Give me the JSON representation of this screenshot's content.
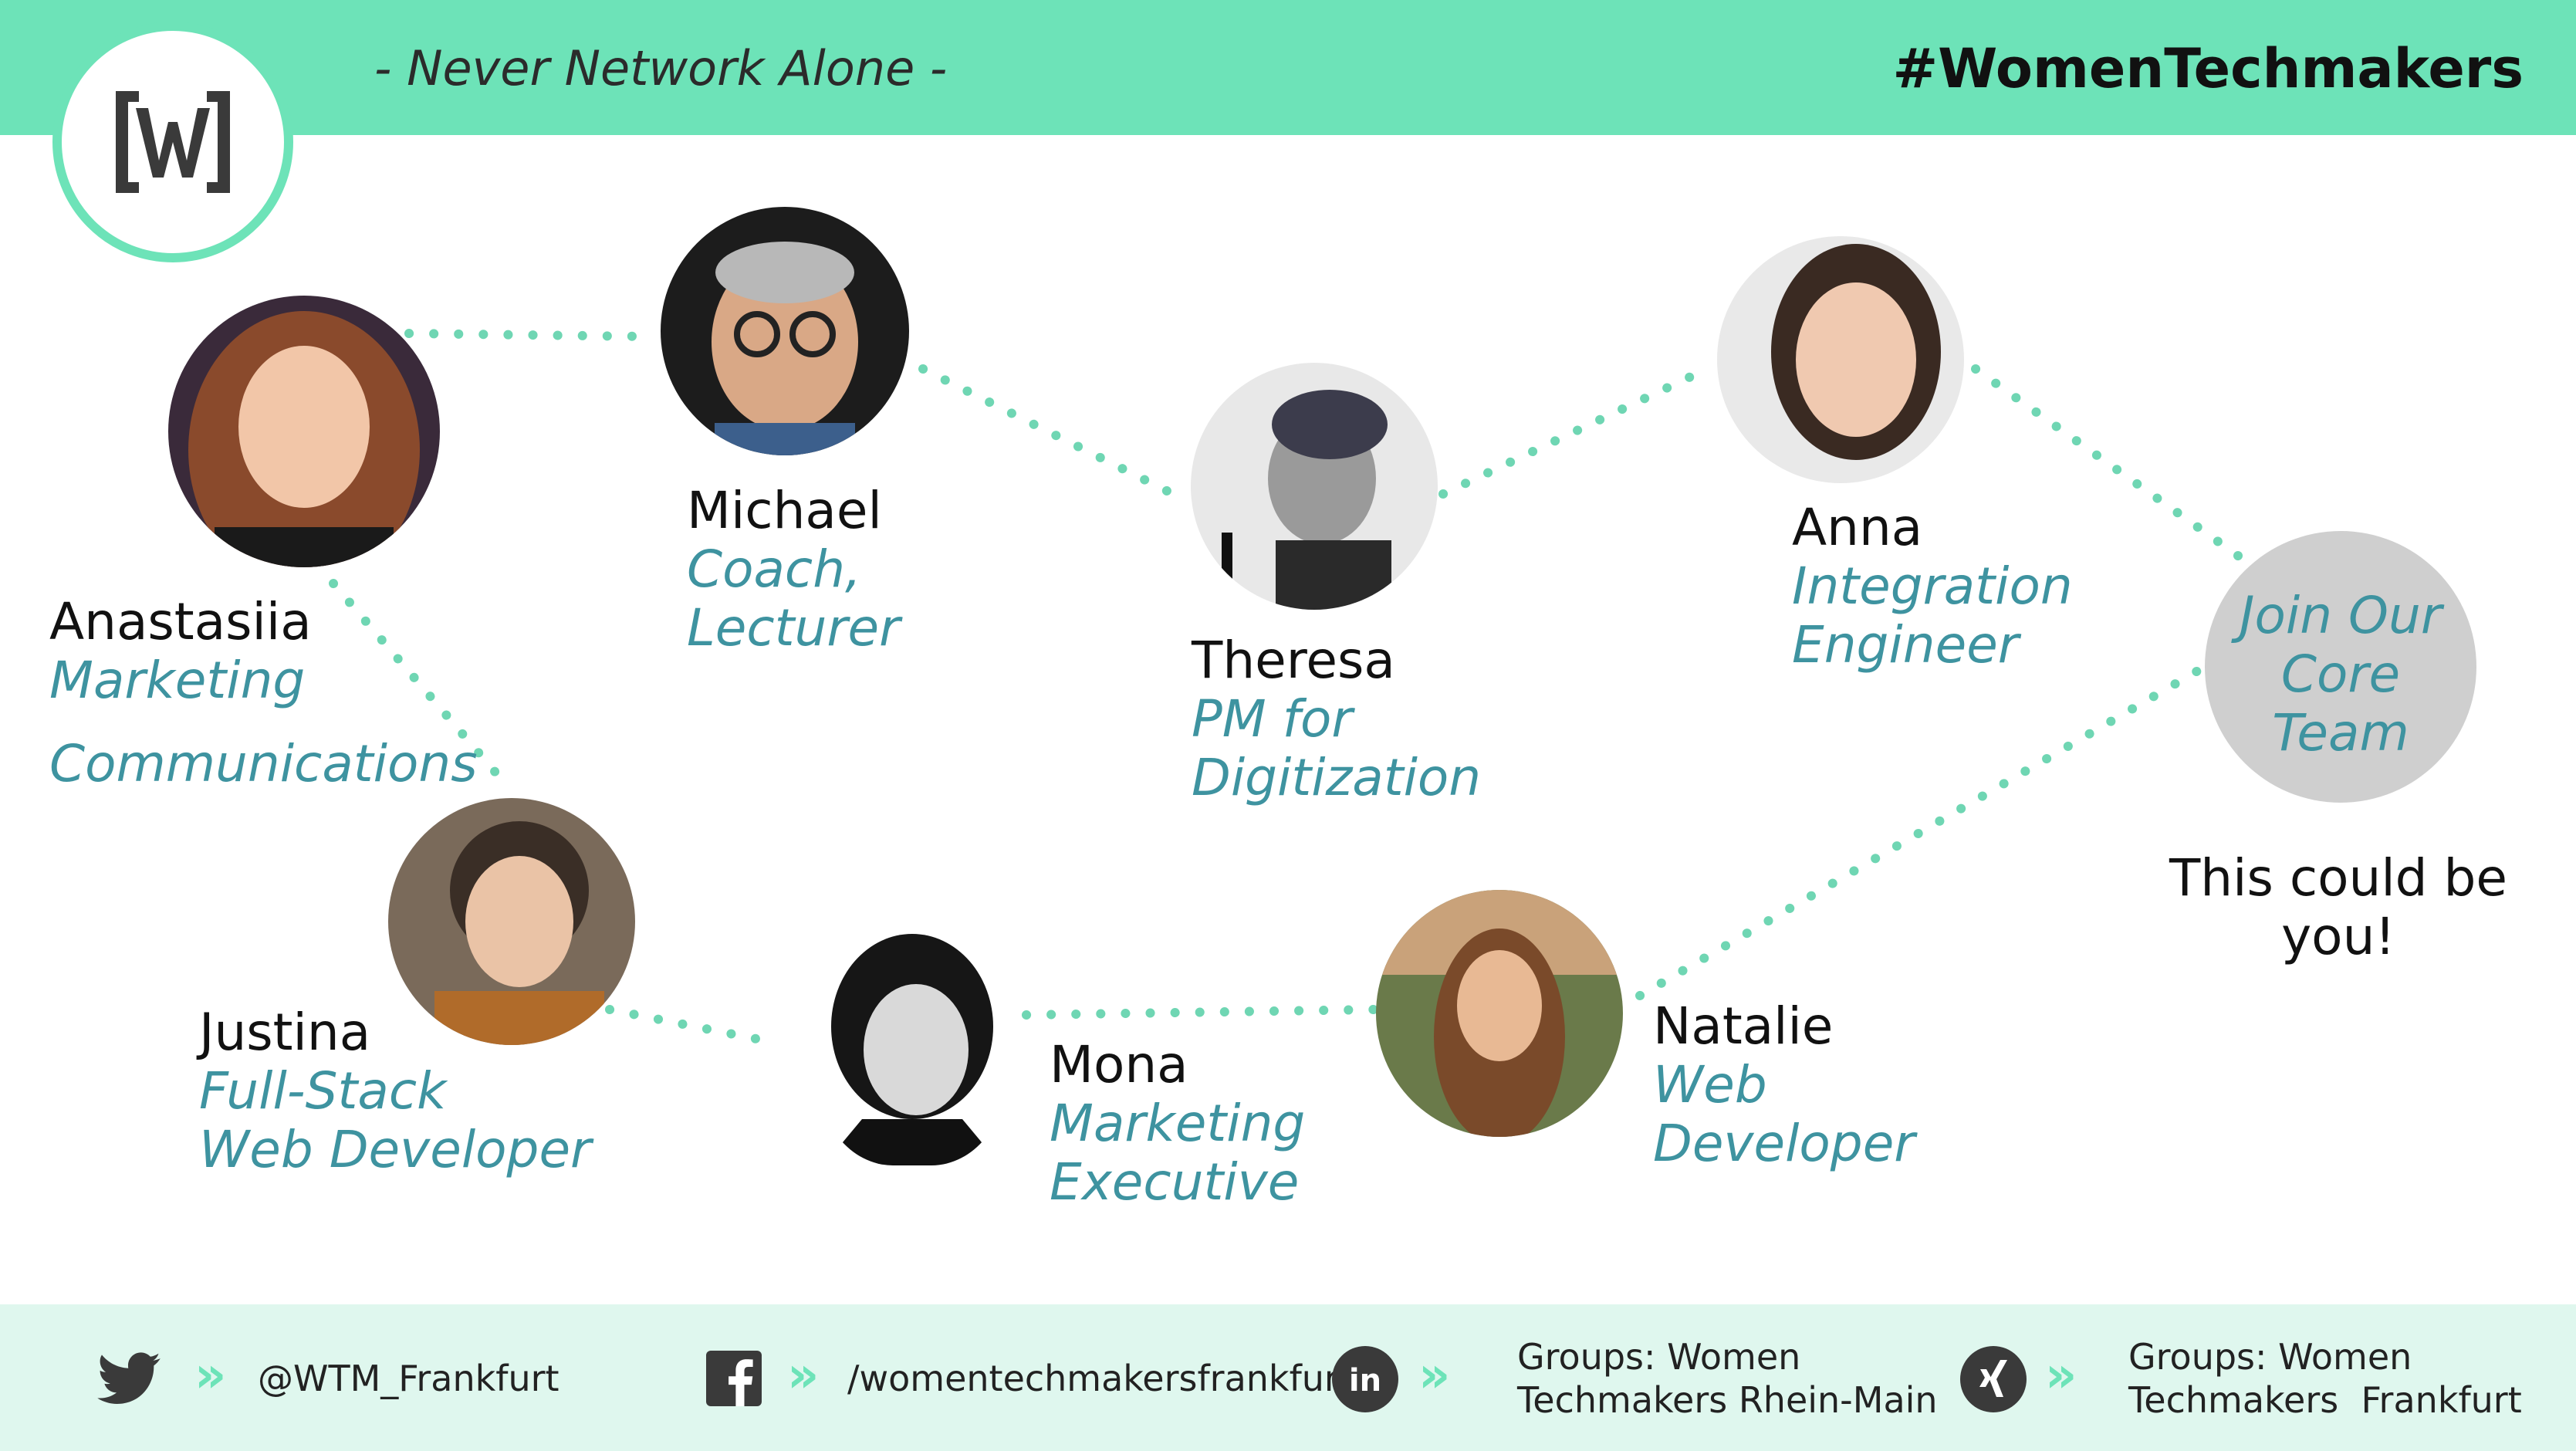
{
  "header": {
    "tagline": "- Never Network Alone -",
    "hashtag": "#WomenTechmakers"
  },
  "colors": {
    "accent": "#6de3b8",
    "role_text": "#3e93a0",
    "footer_bg": "#dff7ee",
    "placeholder_circle": "#cfcfcf"
  },
  "team": [
    {
      "name": "Anastasiia",
      "role_line1": "Marketing",
      "role_line2": "Communications"
    },
    {
      "name": "Michael",
      "role_line1": "Coach,",
      "role_line2": "Lecturer"
    },
    {
      "name": "Theresa",
      "role_line1": "PM for",
      "role_line2": "Digitization"
    },
    {
      "name": "Anna",
      "role_line1": "Integration",
      "role_line2": "Engineer"
    },
    {
      "name": "Justina",
      "role_line1": "Full-Stack",
      "role_line2": "Web Developer"
    },
    {
      "name": "Mona",
      "role_line1": "Marketing",
      "role_line2": "Executive"
    },
    {
      "name": "Natalie",
      "role_line1": "Web",
      "role_line2": "Developer"
    }
  ],
  "join": {
    "line1": "Join Our",
    "line2": "Core",
    "line3": "Team",
    "caption_line1": "This could be",
    "caption_line2": "you!"
  },
  "footer": {
    "twitter": "@WTM_Frankfurt",
    "facebook": "/womentechmakersfrankfurt",
    "linkedin_line1": "Groups: Women",
    "linkedin_line2": "Techmakers Rhein-Main",
    "xing_line1": "Groups: Women",
    "xing_line2": "Techmakers  Frankfurt",
    "chevron": "»"
  }
}
